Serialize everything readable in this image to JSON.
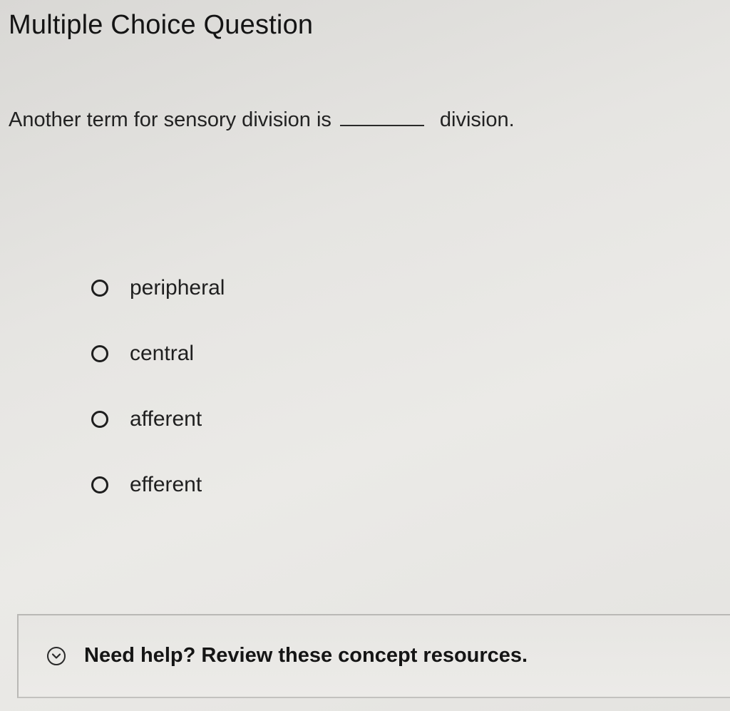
{
  "header": {
    "title": "Multiple Choice Question"
  },
  "question": {
    "prefix": "Another term for sensory division is",
    "suffix": "division."
  },
  "options": [
    {
      "label": "peripheral"
    },
    {
      "label": "central"
    },
    {
      "label": "afferent"
    },
    {
      "label": "efferent"
    }
  ],
  "help": {
    "label": "Need help? Review these concept resources.",
    "icon": "chevron-down-circle-icon"
  }
}
